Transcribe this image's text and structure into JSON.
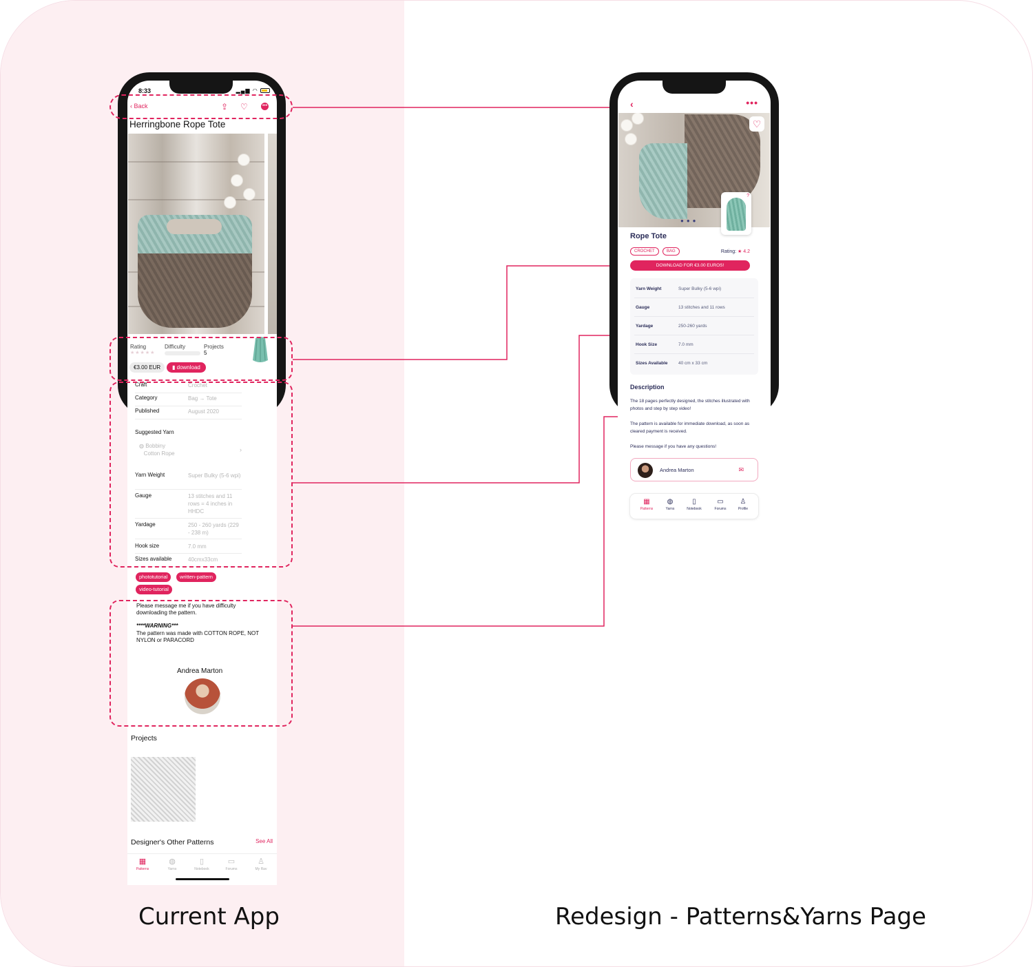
{
  "captions": {
    "left": "Current App",
    "right": "Redesign - Patterns&Yarns Page"
  },
  "current_app": {
    "status_time": "8:33",
    "nav": {
      "back": "Back"
    },
    "title": "Herringbone Rope Tote",
    "meta": {
      "rating_label": "Rating",
      "difficulty_label": "Difficulty",
      "projects_label": "Projects",
      "projects_count": "5"
    },
    "price": "€3.00 EUR",
    "download": "download",
    "specs": [
      {
        "key": "Craft",
        "value": "Crochet"
      },
      {
        "key": "Category",
        "value": "Bag → Tote"
      },
      {
        "key": "Published",
        "value": "August 2020"
      }
    ],
    "suggested_yarn": {
      "label": "Suggested Yarn",
      "brand": "Bobbiny",
      "name": "Cotton Rope"
    },
    "yarn_specs": [
      {
        "key": "Yarn Weight",
        "value": "Super Bulky (5-6 wpi)"
      },
      {
        "key": "Gauge",
        "value": "13 stitches and 11 rows = 4 inches in HHDC"
      },
      {
        "key": "Yardage",
        "value": "250 - 260 yards (229 - 238 m)"
      },
      {
        "key": "Hook size",
        "value": "7.0 mm"
      },
      {
        "key": "Sizes available",
        "value": "40cmx33cm"
      }
    ],
    "tags": [
      "phototutorial",
      "written-pattern",
      "video-tutorial"
    ],
    "notes": {
      "message": "Please message me if you have difficulty downloading the pattern.",
      "warning_title": "****WARNING***",
      "warning_body": "The pattern was made with COTTON ROPE, NOT NYLON or PARACORD"
    },
    "author": "Andrea Marton",
    "projects_heading": "Projects",
    "other_patterns_heading": "Designer's Other Patterns",
    "see_all": "See All",
    "tabs": [
      "Patterns",
      "Yarns",
      "Notebook",
      "Forums",
      "My Rav"
    ],
    "accent": "#e0245e"
  },
  "redesign": {
    "title": "Rope Tote",
    "chips": [
      "CROCHET",
      "BAG"
    ],
    "rating_label": "Rating:",
    "rating_value": "4.2",
    "download_cta": "DOWNLOAD FOR €3.00 EUROS!",
    "specs": [
      {
        "key": "Yarn Weight",
        "value": "Super Bulky (5-6 wpi)"
      },
      {
        "key": "Gauge",
        "value": "13 stitches and 11 rows"
      },
      {
        "key": "Yardage",
        "value": "250-260 yards"
      },
      {
        "key": "Hook Size",
        "value": "7.0 mm"
      },
      {
        "key": "Sizes Available",
        "value": "40 cm x 33 cm"
      }
    ],
    "description_heading": "Description",
    "description": [
      "The 18 pages perfectly designed, the stitches illustrated with photos and step by step video!",
      "The pattern is available for immediate download, as soon as cleared payment is received.",
      "Please message if you have any questions!"
    ],
    "author": "Andrea Marton",
    "tabs": [
      "Patterns",
      "Yarns",
      "Notebook",
      "Forums",
      "Profile"
    ],
    "text_color": "#2b2d58"
  }
}
